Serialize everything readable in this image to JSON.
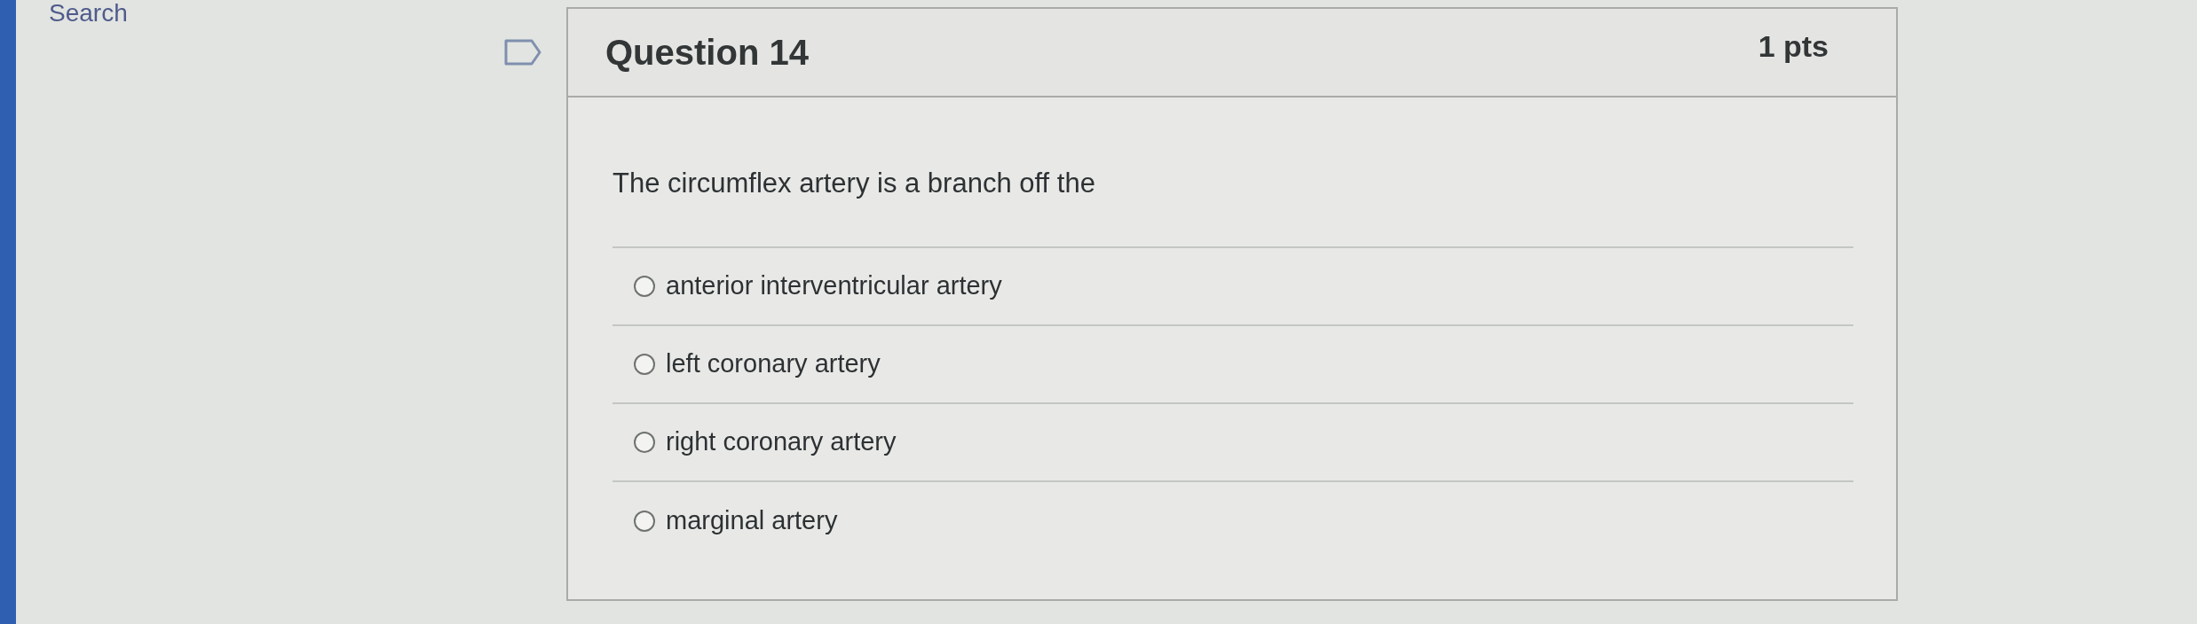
{
  "nav": {
    "search_link": "Search"
  },
  "question": {
    "title": "Question 14",
    "points": "1 pts",
    "flagged": false,
    "text": "The circumflex artery is a branch off the",
    "answers": [
      {
        "label": "anterior interventricular artery",
        "selected": false
      },
      {
        "label": "left coronary artery",
        "selected": false
      },
      {
        "label": "right coronary artery",
        "selected": false
      },
      {
        "label": "marginal artery",
        "selected": false
      }
    ]
  }
}
